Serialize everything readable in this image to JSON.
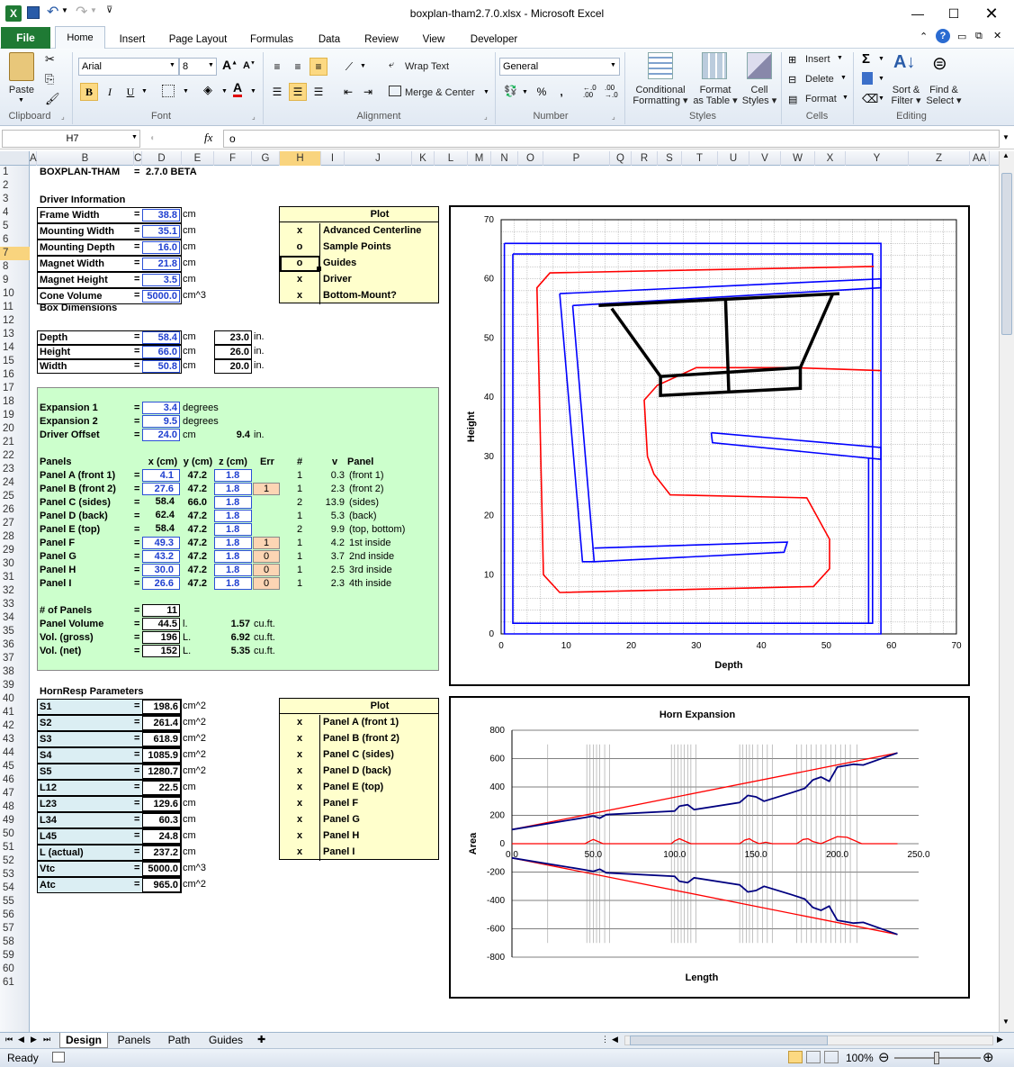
{
  "window": {
    "title": "boxplan-tham2.7.0.xlsx - Microsoft Excel"
  },
  "tabs": [
    "File",
    "Home",
    "Insert",
    "Page Layout",
    "Formulas",
    "Data",
    "Review",
    "View",
    "Developer"
  ],
  "ribbon": {
    "clipboard": {
      "paste": "Paste",
      "group": "Clipboard"
    },
    "font": {
      "name": "Arial",
      "size": "8",
      "group": "Font",
      "bold": "B",
      "italic": "I",
      "underline": "U"
    },
    "alignment": {
      "wrap": "Wrap Text",
      "merge": "Merge & Center",
      "group": "Alignment"
    },
    "number": {
      "format": "General",
      "percent": "%",
      "comma": ",",
      "group": "Number",
      "inc": "←.0\n.00",
      "dec": ".00\n→.0"
    },
    "styles": {
      "cond": "Conditional",
      "cond2": "Formatting",
      "table": "Format",
      "table2": "as Table",
      "cell": "Cell",
      "cell2": "Styles",
      "group": "Styles"
    },
    "cells": {
      "insert": "Insert",
      "delete": "Delete",
      "format": "Format",
      "group": "Cells"
    },
    "editing": {
      "sort": "Sort &",
      "sort2": "Filter",
      "find": "Find &",
      "find2": "Select",
      "group": "Editing",
      "sigma": "Σ"
    }
  },
  "formula": {
    "namebox": "H7",
    "fx": "fx",
    "value": "o"
  },
  "columns": [
    "A",
    "B",
    "C",
    "D",
    "E",
    "F",
    "G",
    "H",
    "I",
    "J",
    "K",
    "L",
    "M",
    "N",
    "O",
    "P",
    "Q",
    "R",
    "S",
    "T",
    "U",
    "V",
    "W",
    "X",
    "Y",
    "Z",
    "AA"
  ],
  "rows": [
    "1",
    "2",
    "3",
    "4",
    "5",
    "6",
    "7",
    "8",
    "9",
    "10",
    "11",
    "12",
    "13",
    "14",
    "15",
    "16",
    "17",
    "18",
    "19",
    "20",
    "21",
    "22",
    "23",
    "24",
    "25",
    "26",
    "27",
    "28",
    "29",
    "30",
    "31",
    "32",
    "33",
    "34",
    "35",
    "36",
    "37",
    "38",
    "39",
    "40",
    "41",
    "42",
    "43",
    "44",
    "45",
    "46",
    "47",
    "48",
    "49",
    "50",
    "51",
    "52",
    "53",
    "54",
    "55",
    "56",
    "57",
    "58",
    "59",
    "60",
    "61"
  ],
  "sheet": {
    "title": "BOXPLAN-THAM",
    "title_eq": "=",
    "version": "2.7.0 BETA",
    "driver_header": "Driver Information",
    "driver": [
      {
        "label": "Frame Width",
        "eq": "=",
        "value": "38.8",
        "unit": "cm"
      },
      {
        "label": "Mounting Width",
        "eq": "=",
        "value": "35.1",
        "unit": "cm"
      },
      {
        "label": "Mounting Depth",
        "eq": "=",
        "value": "16.0",
        "unit": "cm"
      },
      {
        "label": "Magnet Width",
        "eq": "=",
        "value": "21.8",
        "unit": "cm"
      },
      {
        "label": "Magnet Height",
        "eq": "=",
        "value": "3.5",
        "unit": "cm"
      },
      {
        "label": "Cone Volume",
        "eq": "=",
        "value": "5000.0",
        "unit": "cm^3"
      }
    ],
    "plot_header": "Plot",
    "plot_options": [
      {
        "mark": "x",
        "label": "Advanced Centerline"
      },
      {
        "mark": "o",
        "label": "Sample Points"
      },
      {
        "mark": "o",
        "label": "Guides"
      },
      {
        "mark": "x",
        "label": "Driver"
      },
      {
        "mark": "x",
        "label": "Bottom-Mount?"
      }
    ],
    "box_header": "Box Dimensions",
    "box": [
      {
        "label": "Depth",
        "eq": "=",
        "value": "58.4",
        "unit": "cm",
        "inches": "23.0",
        "iu": "in."
      },
      {
        "label": "Height",
        "eq": "=",
        "value": "66.0",
        "unit": "cm",
        "inches": "26.0",
        "iu": "in."
      },
      {
        "label": "Width",
        "eq": "=",
        "value": "50.8",
        "unit": "cm",
        "inches": "20.0",
        "iu": "in."
      }
    ],
    "expansion": [
      {
        "label": "Expansion 1",
        "eq": "=",
        "value": "3.4",
        "unit": "degrees"
      },
      {
        "label": "Expansion 2",
        "eq": "=",
        "value": "9.5",
        "unit": "degrees"
      },
      {
        "label": "Driver Offset",
        "eq": "=",
        "value": "24.0",
        "unit": "cm",
        "extra": "9.4",
        "extra_unit": "in."
      }
    ],
    "panels_headers": {
      "panels": "Panels",
      "x": "x (cm)",
      "y": "y (cm)",
      "z": "z (cm)",
      "err": "Err",
      "num": "#",
      "v": "v",
      "panel": "Panel"
    },
    "panels": [
      {
        "label": "Panel A (front 1)",
        "eq": "=",
        "x": "4.1",
        "y": "47.2",
        "z": "1.8",
        "err": "",
        "num": "1",
        "v": "0.3",
        "panel": "(front 1)"
      },
      {
        "label": "Panel B (front 2)",
        "eq": "=",
        "x": "27.6",
        "y": "47.2",
        "z": "1.8",
        "err": "1",
        "num": "1",
        "v": "2.3",
        "panel": "(front 2)"
      },
      {
        "label": "Panel C (sides)",
        "eq": "=",
        "x": "58.4",
        "y": "66.0",
        "z": "1.8",
        "err": "",
        "num": "2",
        "v": "13.9",
        "panel": "(sides)"
      },
      {
        "label": "Panel D (back)",
        "eq": "=",
        "x": "62.4",
        "y": "47.2",
        "z": "1.8",
        "err": "",
        "num": "1",
        "v": "5.3",
        "panel": "(back)"
      },
      {
        "label": "Panel E (top)",
        "eq": "=",
        "x": "58.4",
        "y": "47.2",
        "z": "1.8",
        "err": "",
        "num": "2",
        "v": "9.9",
        "panel": "(top, bottom)"
      },
      {
        "label": "Panel F",
        "eq": "=",
        "x": "49.3",
        "y": "47.2",
        "z": "1.8",
        "err": "1",
        "num": "1",
        "v": "4.2",
        "panel": "1st inside"
      },
      {
        "label": "Panel G",
        "eq": "=",
        "x": "43.2",
        "y": "47.2",
        "z": "1.8",
        "err": "0",
        "num": "1",
        "v": "3.7",
        "panel": "2nd inside"
      },
      {
        "label": "Panel H",
        "eq": "=",
        "x": "30.0",
        "y": "47.2",
        "z": "1.8",
        "err": "0",
        "num": "1",
        "v": "2.5",
        "panel": "3rd inside"
      },
      {
        "label": "Panel I",
        "eq": "=",
        "x": "26.6",
        "y": "47.2",
        "z": "1.8",
        "err": "0",
        "num": "1",
        "v": "2.3",
        "panel": "4th inside"
      }
    ],
    "totals": [
      {
        "label": "# of Panels",
        "eq": "=",
        "value": "11",
        "unit": "",
        "cf": "",
        "cfu": ""
      },
      {
        "label": "Panel Volume",
        "eq": "=",
        "value": "44.5",
        "unit": "l.",
        "cf": "1.57",
        "cfu": "cu.ft."
      },
      {
        "label": "Vol. (gross)",
        "eq": "=",
        "value": "196",
        "unit": "L.",
        "cf": "6.92",
        "cfu": "cu.ft."
      },
      {
        "label": "Vol. (net)",
        "eq": "=",
        "value": "152",
        "unit": "L.",
        "cf": "5.35",
        "cfu": "cu.ft."
      }
    ],
    "hornresp_header": "HornResp Parameters",
    "hornresp": [
      {
        "label": "S1",
        "eq": "=",
        "value": "198.6",
        "unit": "cm^2"
      },
      {
        "label": "S2",
        "eq": "=",
        "value": "261.4",
        "unit": "cm^2"
      },
      {
        "label": "S3",
        "eq": "=",
        "value": "618.9",
        "unit": "cm^2"
      },
      {
        "label": "S4",
        "eq": "=",
        "value": "1085.9",
        "unit": "cm^2"
      },
      {
        "label": "S5",
        "eq": "=",
        "value": "1280.7",
        "unit": "cm^2"
      },
      {
        "label": "L12",
        "eq": "=",
        "value": "22.5",
        "unit": "cm"
      },
      {
        "label": "L23",
        "eq": "=",
        "value": "129.6",
        "unit": "cm"
      },
      {
        "label": "L34",
        "eq": "=",
        "value": "60.3",
        "unit": "cm"
      },
      {
        "label": "L45",
        "eq": "=",
        "value": "24.8",
        "unit": "cm"
      },
      {
        "label": "L (actual)",
        "eq": "=",
        "value": "237.2",
        "unit": "cm"
      },
      {
        "label": "Vtc",
        "eq": "=",
        "value": "5000.0",
        "unit": "cm^3"
      },
      {
        "label": "Atc",
        "eq": "=",
        "value": "965.0",
        "unit": "cm^2"
      }
    ],
    "plot2_header": "Plot",
    "plot2_options": [
      {
        "mark": "x",
        "label": "Panel A (front 1)"
      },
      {
        "mark": "x",
        "label": "Panel B (front 2)"
      },
      {
        "mark": "x",
        "label": "Panel C (sides)"
      },
      {
        "mark": "x",
        "label": "Panel D (back)"
      },
      {
        "mark": "x",
        "label": "Panel E (top)"
      },
      {
        "mark": "x",
        "label": "Panel F"
      },
      {
        "mark": "x",
        "label": "Panel G"
      },
      {
        "mark": "x",
        "label": "Panel H"
      },
      {
        "mark": "x",
        "label": "Panel I"
      }
    ]
  },
  "sheet_tabs": [
    "Design",
    "Panels",
    "Path",
    "Guides"
  ],
  "status": {
    "ready": "Ready",
    "zoom": "100%"
  },
  "colors": {
    "file_tab": "#1f7a34",
    "green_panel": "#ccffcc",
    "yellow_panel": "#ffffcc",
    "blue_cells": "#dbeef3",
    "err_fill": "#fcd5b4",
    "selection": "#f9d47e"
  },
  "chart_data": [
    {
      "type": "scatter",
      "title": "",
      "xlabel": "Depth",
      "ylabel": "Height",
      "xlim": [
        0,
        70
      ],
      "ylim": [
        0,
        70
      ],
      "xticks": [
        "0",
        "10",
        "20",
        "30",
        "40",
        "50",
        "60",
        "70"
      ],
      "yticks": [
        "0",
        "10",
        "20",
        "30",
        "40",
        "50",
        "60",
        "70"
      ],
      "grid": true,
      "series": [
        {
          "color": "#0000ff",
          "paths": [
            [
              [
                0.5,
                66
              ],
              [
                58.4,
                66
              ],
              [
                58.4,
                0
              ],
              [
                0.5,
                0
              ],
              [
                0.5,
                66
              ]
            ],
            [
              [
                1.8,
                64.2
              ],
              [
                57.1,
                64.2
              ],
              [
                57.1,
                1.8
              ],
              [
                1.8,
                1.8
              ],
              [
                1.8,
                64.2
              ]
            ],
            [
              [
                9,
                57.5
              ],
              [
                58.4,
                60
              ],
              [
                58.4,
                58.5
              ],
              [
                11,
                55.5
              ]
            ],
            [
              [
                9,
                57.5
              ],
              [
                12.5,
                12.2
              ],
              [
                14.3,
                12.2
              ],
              [
                11,
                55.5
              ]
            ],
            [
              [
                14.3,
                14.5
              ],
              [
                44,
                15.5
              ],
              [
                43.5,
                13.8
              ],
              [
                14.3,
                12.2
              ]
            ],
            [
              [
                32.3,
                34
              ],
              [
                58.4,
                31.5
              ],
              [
                58.4,
                29.5
              ],
              [
                32.5,
                32.3
              ],
              [
                32.3,
                34
              ]
            ],
            [
              [
                56.5,
                29.6
              ],
              [
                56.5,
                1.8
              ]
            ]
          ]
        },
        {
          "color": "#ff0000",
          "paths": [
            [
              [
                57.3,
                62.1
              ],
              [
                7.5,
                61
              ],
              [
                5.5,
                58.5
              ],
              [
                6.5,
                10
              ],
              [
                9,
                7
              ],
              [
                48,
                8
              ],
              [
                50.5,
                11
              ],
              [
                50.5,
                16
              ],
              [
                48.5,
                20
              ],
              [
                47,
                23
              ],
              [
                26,
                23.5
              ],
              [
                23.5,
                27
              ],
              [
                22.5,
                30
              ],
              [
                22,
                39.5
              ],
              [
                24,
                42
              ],
              [
                30,
                45
              ],
              [
                45,
                45
              ],
              [
                58.4,
                44.5
              ]
            ]
          ]
        },
        {
          "color": "#000000",
          "paths": [
            [
              [
                15,
                55.5
              ],
              [
                52,
                57.5
              ]
            ],
            [
              [
                17,
                55
              ],
              [
                24.5,
                43.5
              ],
              [
                24.5,
                40.3
              ],
              [
                46,
                41.5
              ],
              [
                46,
                45
              ],
              [
                51,
                57.5
              ]
            ],
            [
              [
                24.5,
                43.5
              ],
              [
                46,
                45
              ]
            ],
            [
              [
                34.5,
                56.5
              ],
              [
                35,
                41
              ]
            ]
          ]
        }
      ]
    },
    {
      "type": "line",
      "title": "Horn Expansion",
      "xlabel": "Length",
      "ylabel": "Area",
      "xlim": [
        0,
        250
      ],
      "ylim": [
        -800,
        800
      ],
      "xticks": [
        "0.0",
        "50.0",
        "100.0",
        "150.0",
        "200.0",
        "250.0"
      ],
      "yticks": [
        "800",
        "600",
        "400",
        "200",
        "0",
        "-200",
        "-400",
        "-600",
        "-800"
      ],
      "series": [
        {
          "color": "#ff0000",
          "x": [
            0,
            237
          ],
          "y": [
            100,
            640
          ]
        },
        {
          "color": "#ff0000",
          "x": [
            0,
            237
          ],
          "y": [
            -100,
            -640
          ]
        },
        {
          "color": "#000080",
          "x": [
            0,
            45,
            50,
            54,
            58,
            100,
            103,
            108,
            112,
            140,
            145,
            150,
            155,
            172,
            180,
            185,
            190,
            195,
            200,
            210,
            216,
            237
          ],
          "y": [
            100,
            185,
            195,
            180,
            205,
            230,
            265,
            275,
            240,
            290,
            340,
            330,
            300,
            360,
            390,
            450,
            470,
            440,
            540,
            560,
            555,
            640
          ]
        },
        {
          "color": "#000080",
          "x": [
            0,
            45,
            50,
            54,
            58,
            100,
            103,
            108,
            112,
            140,
            145,
            150,
            155,
            172,
            180,
            185,
            190,
            195,
            200,
            210,
            216,
            237
          ],
          "y": [
            -100,
            -185,
            -195,
            -180,
            -205,
            -230,
            -265,
            -275,
            -240,
            -290,
            -340,
            -330,
            -300,
            -360,
            -390,
            -450,
            -470,
            -440,
            -540,
            -560,
            -555,
            -640
          ]
        },
        {
          "color": "#ff0000",
          "x": [
            0,
            45,
            48,
            50,
            53,
            56,
            98,
            100,
            103,
            106,
            110,
            140,
            143,
            146,
            148,
            152,
            156,
            160,
            175,
            179,
            182,
            185,
            190,
            200,
            206,
            215,
            237
          ],
          "y": [
            0,
            0,
            20,
            30,
            15,
            0,
            0,
            20,
            35,
            20,
            0,
            0,
            25,
            35,
            20,
            0,
            10,
            0,
            0,
            30,
            35,
            15,
            0,
            50,
            45,
            0,
            0
          ]
        }
      ]
    }
  ]
}
